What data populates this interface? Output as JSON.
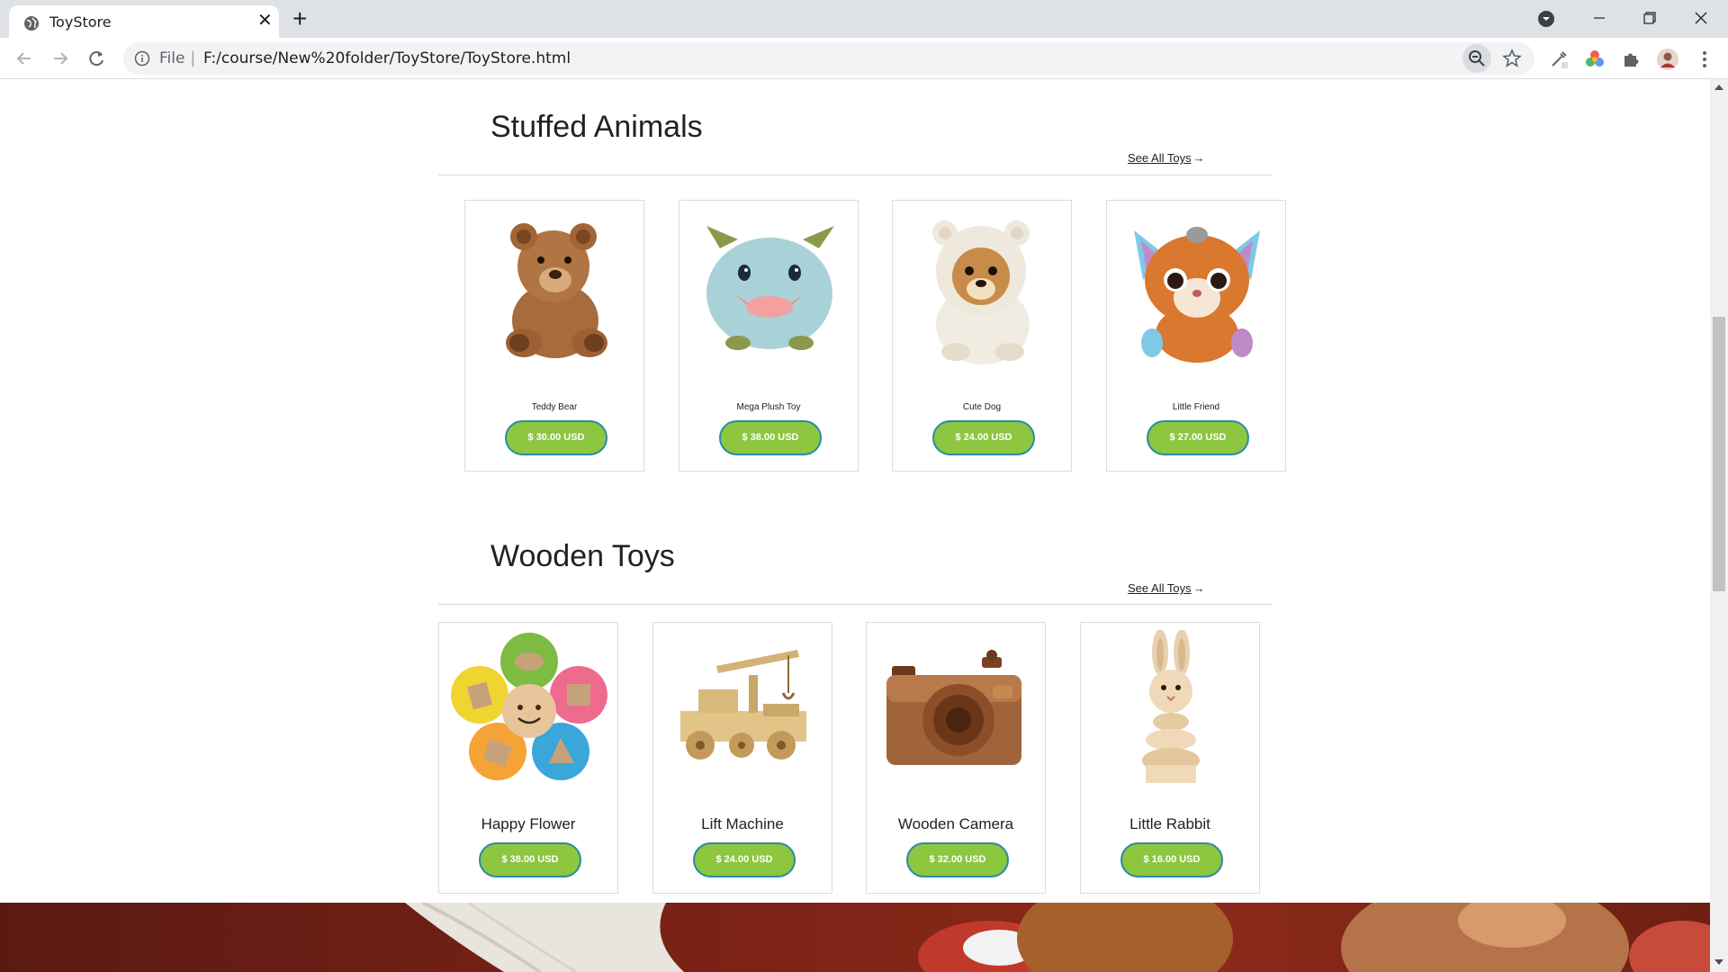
{
  "browser": {
    "tab_title": "ToyStore",
    "omnibox_scheme": "File",
    "omnibox_separator": "|",
    "url": "F:/course/New%20folder/ToyStore/ToyStore.html"
  },
  "sections": [
    {
      "title": "Stuffed Animals",
      "see_all": "See All Toys",
      "products": [
        {
          "name": "Teddy Bear",
          "price": "$ 30.00 USD",
          "icon": "teddy-bear"
        },
        {
          "name": "Mega Plush Toy",
          "price": "$ 38.00 USD",
          "icon": "plush-monster"
        },
        {
          "name": "Cute Dog",
          "price": "$ 24.00 USD",
          "icon": "dog-in-hoodie"
        },
        {
          "name": "Little Friend",
          "price": "$ 27.00 USD",
          "icon": "fox-plush"
        }
      ]
    },
    {
      "title": "Wooden Toys",
      "see_all": "See All Toys",
      "products": [
        {
          "name": "Happy Flower",
          "price": "$ 38.00 USD",
          "icon": "flower-shape-sorter"
        },
        {
          "name": "Lift Machine",
          "price": "$ 24.00 USD",
          "icon": "wooden-crane-truck"
        },
        {
          "name": "Wooden Camera",
          "price": "$ 32.00 USD",
          "icon": "wooden-camera"
        },
        {
          "name": "Little Rabbit",
          "price": "$ 16.00 USD",
          "icon": "wooden-rabbit"
        }
      ]
    }
  ],
  "colors": {
    "price_button": "#8dc63f",
    "price_button_border": "#2a8aa6"
  }
}
